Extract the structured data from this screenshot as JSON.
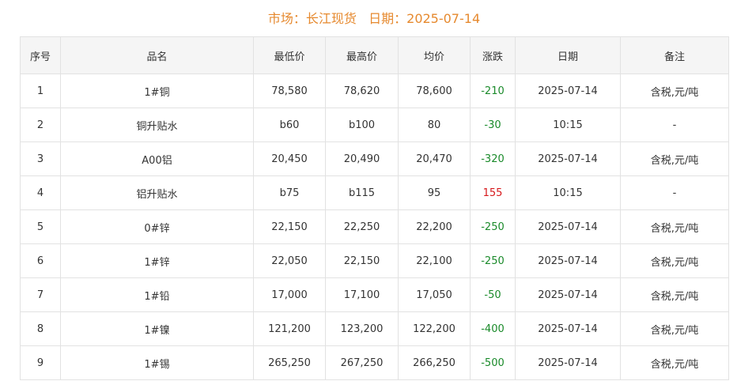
{
  "header": {
    "title": "市场：长江现货   日期：2025-07-14"
  },
  "table": {
    "columns": [
      "序号",
      "品名",
      "最低价",
      "最高价",
      "均价",
      "涨跌",
      "日期",
      "备注"
    ],
    "rows": [
      {
        "index": "1",
        "name": "1#铜",
        "low": "78,580",
        "high": "78,620",
        "avg": "78,600",
        "change": "-210",
        "date": "2025-07-14",
        "note": "含税,元/吨"
      },
      {
        "index": "2",
        "name": "铜升贴水",
        "low": "b60",
        "high": "b100",
        "avg": "80",
        "change": "-30",
        "date": "10:15",
        "note": "-"
      },
      {
        "index": "3",
        "name": "A00铝",
        "low": "20,450",
        "high": "20,490",
        "avg": "20,470",
        "change": "-320",
        "date": "2025-07-14",
        "note": "含税,元/吨"
      },
      {
        "index": "4",
        "name": "铝升贴水",
        "low": "b75",
        "high": "b115",
        "avg": "95",
        "change": "155",
        "date": "10:15",
        "note": "-"
      },
      {
        "index": "5",
        "name": "0#锌",
        "low": "22,150",
        "high": "22,250",
        "avg": "22,200",
        "change": "-250",
        "date": "2025-07-14",
        "note": "含税,元/吨"
      },
      {
        "index": "6",
        "name": "1#锌",
        "low": "22,050",
        "high": "22,150",
        "avg": "22,100",
        "change": "-250",
        "date": "2025-07-14",
        "note": "含税,元/吨"
      },
      {
        "index": "7",
        "name": "1#铅",
        "low": "17,000",
        "high": "17,100",
        "avg": "17,050",
        "change": "-50",
        "date": "2025-07-14",
        "note": "含税,元/吨"
      },
      {
        "index": "8",
        "name": "1#镍",
        "low": "121,200",
        "high": "123,200",
        "avg": "122,200",
        "change": "-400",
        "date": "2025-07-14",
        "note": "含税,元/吨"
      },
      {
        "index": "9",
        "name": "1#锡",
        "low": "265,250",
        "high": "267,250",
        "avg": "266,250",
        "change": "-500",
        "date": "2025-07-14",
        "note": "含税,元/吨"
      }
    ]
  },
  "colors": {
    "title": "#e6892e",
    "change_down": "#1a8a2a",
    "change_up": "#d6181b",
    "header_bg": "#f5f5f5",
    "border": "#e2e2e2"
  }
}
